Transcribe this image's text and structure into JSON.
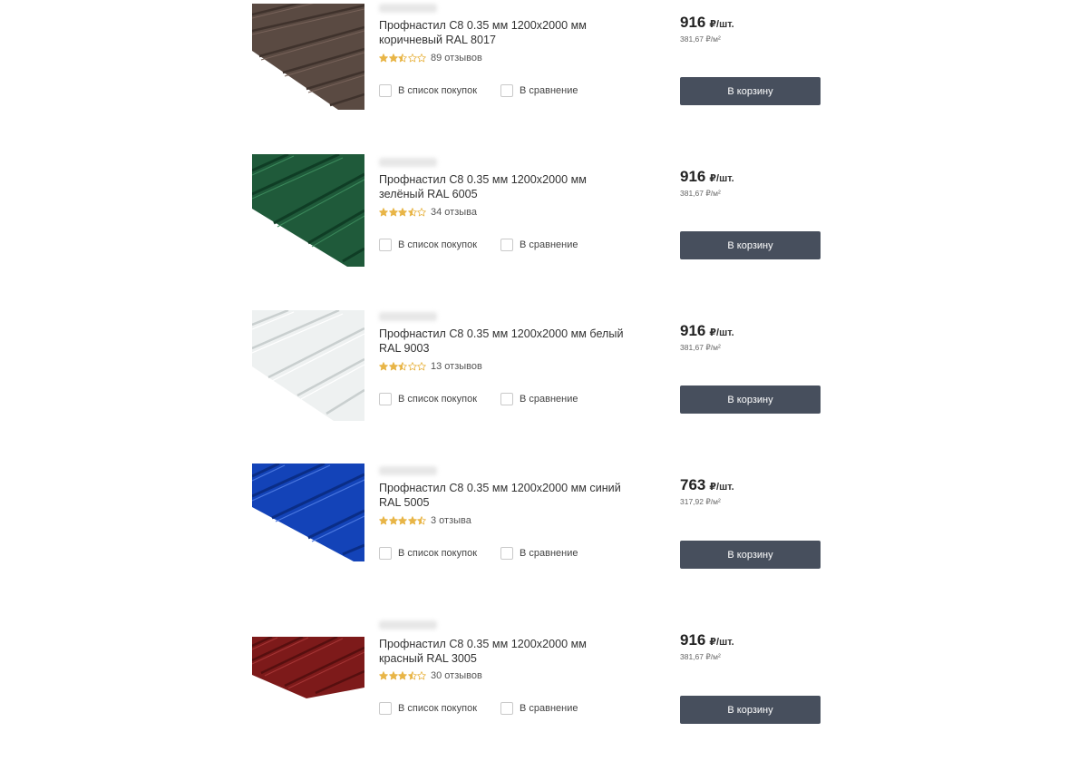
{
  "products": [
    {
      "title_line1": "Профнастил С8 0.35 мм 1200х2000 мм",
      "title_line2": "коричневый RAL 8017",
      "rating": 2.5,
      "reviews": "89 отзывов",
      "shopping_list_label": "В список покупок",
      "compare_label": "В сравнение",
      "price": "916",
      "price_unit": "₽/шт.",
      "price_per_sqm": "381,67 ₽/м²",
      "cart_label": "В корзину",
      "color": "#5a4a42"
    },
    {
      "title_line1": "Профнастил С8 0.35 мм 1200х2000 мм",
      "title_line2": "зелёный RAL 6005",
      "rating": 3.5,
      "reviews": "34 отзыва",
      "shopping_list_label": "В список покупок",
      "compare_label": "В сравнение",
      "price": "916",
      "price_unit": "₽/шт.",
      "price_per_sqm": "381,67 ₽/м²",
      "cart_label": "В корзину",
      "color": "#1f5a3a"
    },
    {
      "title_line1": "Профнастил С8 0.35 мм 1200х2000 мм белый",
      "title_line2": "RAL 9003",
      "rating": 2.5,
      "reviews": "13 отзывов",
      "shopping_list_label": "В список покупок",
      "compare_label": "В сравнение",
      "price": "916",
      "price_unit": "₽/шт.",
      "price_per_sqm": "381,67 ₽/м²",
      "cart_label": "В корзину",
      "color": "#e9ecec"
    },
    {
      "title_line1": "Профнастил С8 0.35 мм 1200х2000 мм синий",
      "title_line2": "RAL 5005",
      "rating": 4.5,
      "reviews": "3 отзыва",
      "shopping_list_label": "В список покупок",
      "compare_label": "В сравнение",
      "price": "763",
      "price_unit": "₽/шт.",
      "price_per_sqm": "317,92 ₽/м²",
      "cart_label": "В корзину",
      "color": "#1343b8"
    },
    {
      "title_line1": "Профнастил С8 0.35 мм 1200х2000 мм",
      "title_line2": "красный RAL 3005",
      "rating": 3.5,
      "reviews": "30 отзывов",
      "shopping_list_label": "В список покупок",
      "compare_label": "В сравнение",
      "price": "916",
      "price_unit": "₽/шт.",
      "price_per_sqm": "381,67 ₽/м²",
      "cart_label": "В корзину",
      "color": "#7d1a1a"
    }
  ],
  "star_color": "#e8b547",
  "button_color": "#474f5d"
}
